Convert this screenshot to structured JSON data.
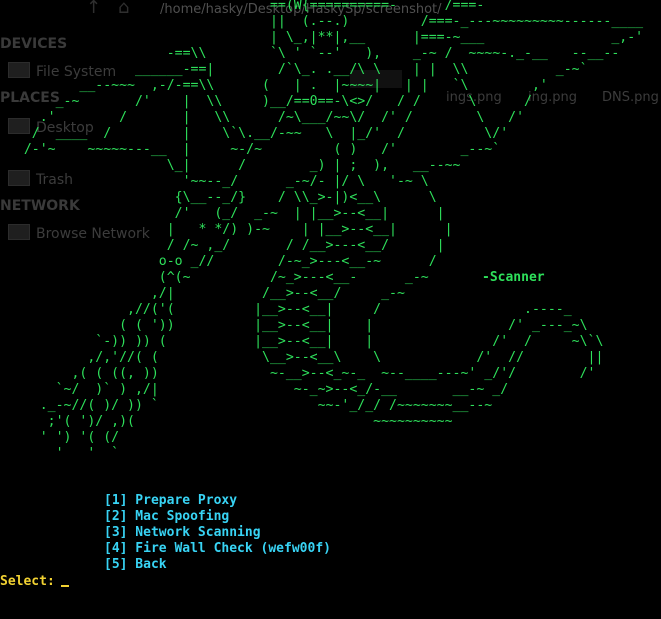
{
  "background_window": {
    "path": "/home/hasky/Desktop/HaskySp/screenshot/",
    "sections": [
      "DEVICES",
      "PLACES",
      "NETWORK"
    ],
    "items": [
      "File System",
      "Desktop",
      "Trash",
      "Browse Network"
    ],
    "files": [
      "ings.png",
      "ing.png",
      "DNS.png"
    ]
  },
  "terminal": {
    "ascii_art": "                                  ==(W{==========-      /===-\n                                  ||  (.--.)         /===-_---~~~~~~~~~------____\n                                  | \\_,|**|,__      |===-~___                _,-'\n                     -==\\\\        `\\ ' `--'   ),    _-~ /  ~~~~-._-__   --__--\n                 ______-==|        /`\\_. .__/\\ \\    | |  \\\\           _-~`\n          __--~~~  ,-/-==\\\\      (   | .  |~~~~|   | |   `\\        ,'\n       _-~       /'    |  \\\\     )__/==0==-\\<>/   / /      \\      /\n     .'        /       |   \\\\      /~\\___/~~\\/  /' /        \\   /'\n    /  ____  /         |    \\`\\.__/-~~   \\  |_/'  /          \\/'\n   /-'~    ~~~~~---__  |     ~-/~         ( )   /'        _--~`\n                     \\_|      /        _) | ;  ),   __--~~\n                       '~~--_/      _-~/- |/ \\   '-~ \\\n                      {\\__--_/}    / \\\\_>-|)<__\\      \\\n                      /'   (_/  _-~  | |__>--<__|      |\n                     |   * */) )-~    | |__>--<__|      |\n                     / /~ ,_/       / /__>---<__/      |\n                    o-o _//        /-~_>---<__-~      /\n                    (^(~          /~_>---<__-      _-~\n                   ,/|           /__>--<__/     _-~\n                ,//('(          |__>--<__|     /                  .----_\n               ( ( '))          |__>--<__|    |                 /' _---_~\\\n            `-)) )) (           |__>--<__|    |               /'  /     ~\\`\\\n           ,/,'//( (             \\__>--<__\\    \\            /'  //        ||\n         ,( ( ((, ))              ~-__>--<_~-_  ~--____---~' _/'/        /'\n       `~/  )` ) ,/|                 ~-_~>--<_/-__       __-~ _/\n     ._-~//( )/ )) `                    ~~-'_/_/ /~~~~~~~__--~\n      ;'( ')/ ,)(                              ~~~~~~~~~~\n     ' ') '( (/\n       '   '  `",
    "scanner_label": "-Scanner",
    "menu": [
      "[1] Prepare Proxy",
      "[2] Mac Spoofing",
      "[3] Network Scanning",
      "[4] Fire Wall Check (wefw00f)",
      "[5] Back"
    ],
    "prompt": "Select:"
  },
  "colors": {
    "background": "#000000",
    "art": "#2ee05b",
    "menu": "#38d4f5",
    "prompt": "#f2d232"
  }
}
